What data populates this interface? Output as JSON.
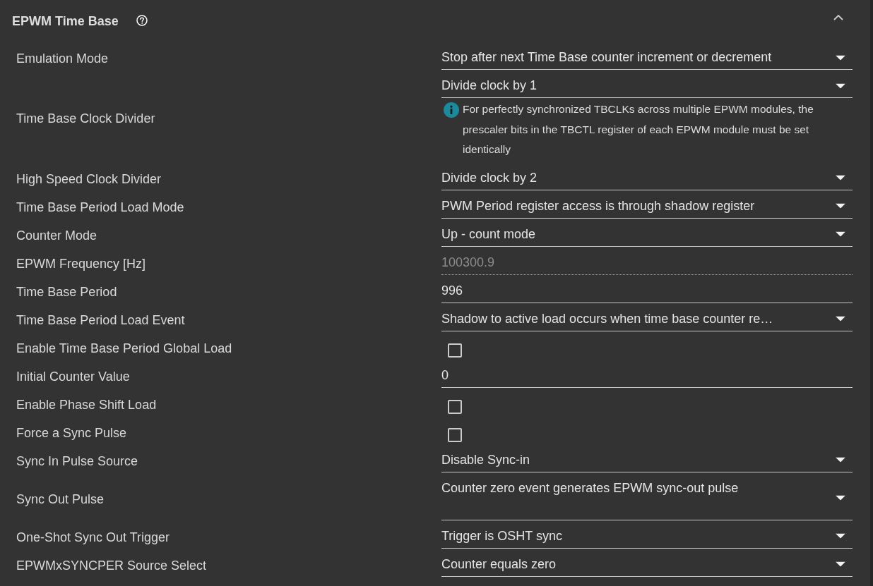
{
  "section": {
    "title": "EPWM Time Base",
    "expanded": true
  },
  "fields": [
    {
      "label": "Emulation Mode",
      "kind": "select",
      "value": "Stop after next Time Base counter increment or decrement"
    },
    {
      "label": "Time Base Clock Divider",
      "kind": "select",
      "value": "Divide clock by 1",
      "note": "For perfectly synchronized TBCLKs across multiple EPWM modules, the prescaler bits in the TBCTL register of each EPWM module must be set identically"
    },
    {
      "label": "High Speed Clock Divider",
      "kind": "select",
      "value": "Divide clock by 2"
    },
    {
      "label": "Time Base Period Load Mode",
      "kind": "select",
      "value": "PWM Period register access is through shadow register"
    },
    {
      "label": "Counter Mode",
      "kind": "select",
      "value": "Up - count mode"
    },
    {
      "label": "EPWM Frequency [Hz]",
      "kind": "text",
      "value": "100300.9",
      "disabled": true
    },
    {
      "label": "Time Base Period",
      "kind": "text",
      "value": "996",
      "disabled": false
    },
    {
      "label": "Time Base Period Load Event",
      "kind": "select",
      "value": "Shadow to active load occurs when time base counter re…"
    },
    {
      "label": "Enable Time Base Period Global Load",
      "kind": "checkbox",
      "checked": false
    },
    {
      "label": "Initial Counter Value",
      "kind": "text",
      "value": "0",
      "disabled": false
    },
    {
      "label": "Enable Phase Shift Load",
      "kind": "checkbox",
      "checked": false
    },
    {
      "label": "Force a Sync Pulse",
      "kind": "checkbox",
      "checked": false
    },
    {
      "label": "Sync In Pulse Source",
      "kind": "select",
      "value": "Disable Sync-in"
    },
    {
      "label": "Sync Out Pulse",
      "kind": "multiselect",
      "value": "Counter zero event generates EPWM sync-out pulse"
    },
    {
      "label": "One-Shot Sync Out Trigger",
      "kind": "select",
      "value": "Trigger is OSHT sync"
    },
    {
      "label": "EPWMxSYNCPER Source Select",
      "kind": "select",
      "value": "Counter equals zero"
    }
  ]
}
